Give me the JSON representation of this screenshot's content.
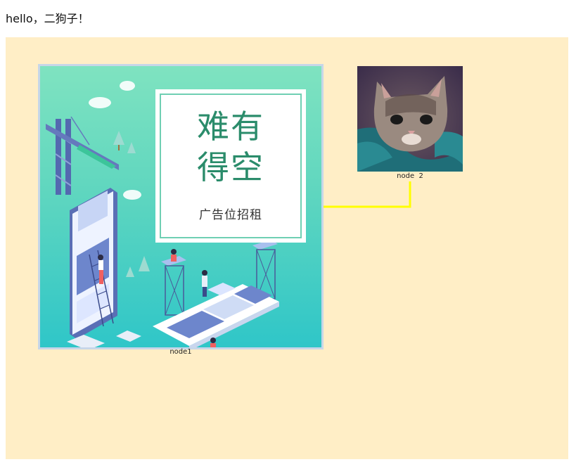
{
  "greeting": "hello，二狗子！",
  "canvas": {
    "background": "#ffeec6",
    "edge_color": "#ffff00"
  },
  "nodes": [
    {
      "label": "node1",
      "image": {
        "icon": "advertisement-illustration",
        "title_line1": "难有",
        "title_line2": "得空",
        "subtitle": "广告位招租"
      }
    },
    {
      "label": "node  2",
      "image": {
        "icon": "kitten-photo"
      }
    }
  ]
}
